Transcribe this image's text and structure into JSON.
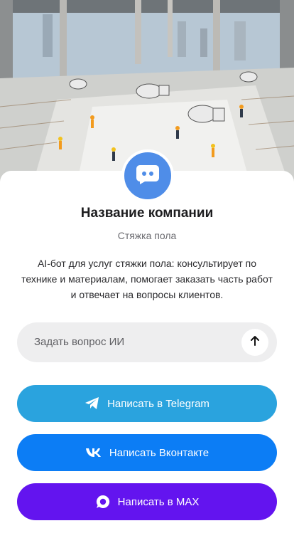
{
  "hero": {
    "image": "construction-site-floor-screed-photo"
  },
  "avatar": {
    "icon": "chat-bot-icon",
    "color": "#4f8de8"
  },
  "company": {
    "name": "Название компании",
    "category": "Стяжка пола",
    "description": "AI-бот для услуг стяжки пола: консультирует по технике и материалам, помогает заказать часть работ и отвечает на вопросы клиентов."
  },
  "ask": {
    "placeholder": "Задать вопрос ИИ",
    "send_icon": "arrow-up-icon"
  },
  "buttons": {
    "telegram": {
      "label": "Написать в Telegram",
      "icon": "telegram-icon",
      "color": "#2aa3de"
    },
    "vk": {
      "label": "Написать Вконтакте",
      "icon": "vk-icon",
      "color": "#0c7df5"
    },
    "max": {
      "label": "Написать в MAX",
      "icon": "max-icon",
      "color": "#6314ef"
    }
  }
}
